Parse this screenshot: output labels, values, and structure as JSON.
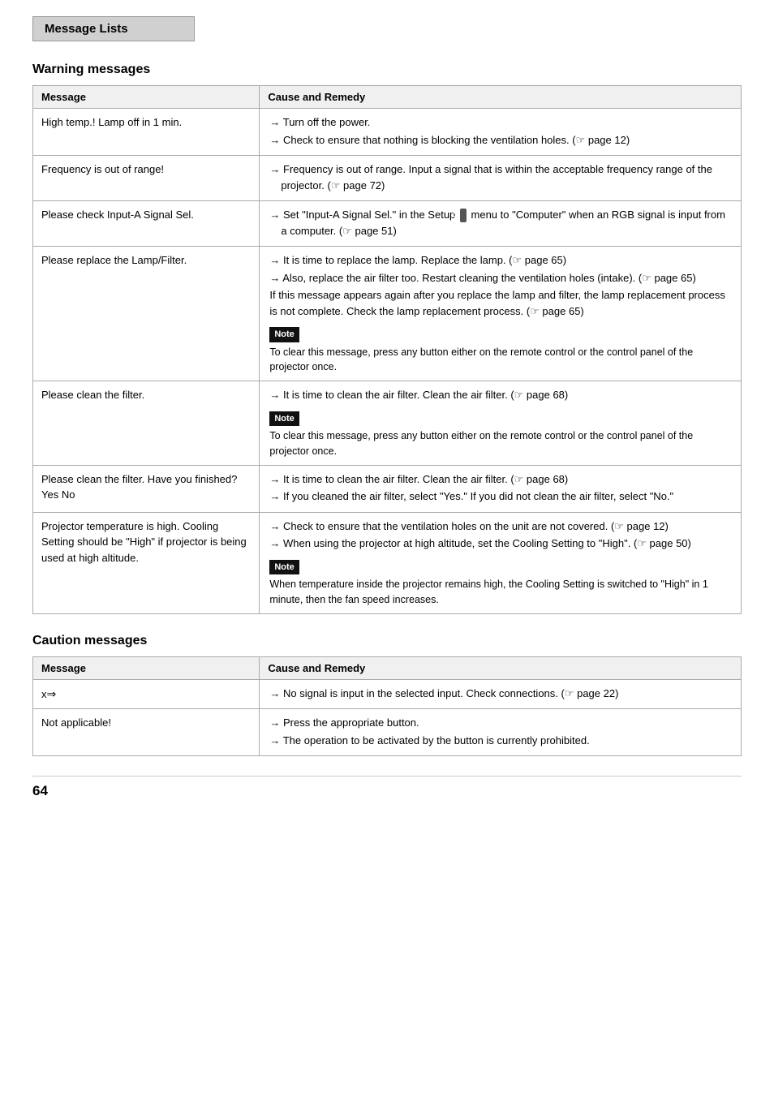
{
  "page": {
    "title": "Message Lists",
    "page_number": "64"
  },
  "warning_section": {
    "heading": "Warning messages",
    "col1": "Message",
    "col2": "Cause and Remedy",
    "rows": [
      {
        "message": "High temp.! Lamp off in 1 min.",
        "remedy": [
          {
            "type": "arrow",
            "text": "Turn off the power."
          },
          {
            "type": "arrow",
            "text": "Check to ensure that nothing is blocking the ventilation holes. (☞ page 12)"
          }
        ],
        "note": null
      },
      {
        "message": "Frequency is out of range!",
        "remedy": [
          {
            "type": "arrow",
            "text": "Frequency is out of range. Input a signal that is within the acceptable frequency range of the projector. (☞ page 72)"
          }
        ],
        "note": null
      },
      {
        "message": "Please check Input-A Signal Sel.",
        "remedy": [
          {
            "type": "arrow",
            "text": "Set \"Input-A Signal Sel.\" in the Setup [icon] menu to \"Computer\" when an RGB signal is input from a computer. (☞ page 51)"
          }
        ],
        "note": null
      },
      {
        "message": "Please replace the Lamp/Filter.",
        "remedy": [
          {
            "type": "arrow",
            "text": "It is time to replace the lamp. Replace the lamp. (☞ page 65)"
          },
          {
            "type": "arrow",
            "text": "Also, replace the air filter too. Restart cleaning the ventilation holes (intake). (☞ page 65)"
          },
          {
            "type": "plain",
            "text": "If this message appears again after you replace the lamp and filter, the lamp replacement process is not complete. Check the lamp replacement process. (☞ page 65)"
          }
        ],
        "note": {
          "label": "Note",
          "text": "To clear this message, press any button either on the remote control or the control panel of the projector once."
        }
      },
      {
        "message": "Please clean the filter.",
        "remedy": [
          {
            "type": "arrow",
            "text": "It is time to clean the air filter. Clean the air filter. (☞ page 68)"
          }
        ],
        "note": {
          "label": "Note",
          "text": "To clear this message, press any button either on the remote control or the control panel of the projector once."
        }
      },
      {
        "message": "Please clean the filter. Have you finished? Yes No",
        "remedy": [
          {
            "type": "arrow",
            "text": "It is time to clean the air filter. Clean the air filter. (☞ page 68)"
          },
          {
            "type": "arrow",
            "text": "If you cleaned the air filter, select \"Yes.\" If you did not clean the air filter, select \"No.\""
          }
        ],
        "note": null
      },
      {
        "message": "Projector temperature is high. Cooling Setting should be \"High\" if projector is being used at high altitude.",
        "remedy": [
          {
            "type": "arrow",
            "text": "Check to ensure that the ventilation holes on the unit are not covered. (☞ page 12)"
          },
          {
            "type": "arrow",
            "text": "When using the projector at high altitude, set the Cooling Setting to \"High\". (☞ page 50)"
          }
        ],
        "note": {
          "label": "Note",
          "text": "When temperature inside the projector remains high, the Cooling Setting is switched to \"High\" in 1 minute, then the fan speed increases."
        }
      }
    ]
  },
  "caution_section": {
    "heading": "Caution messages",
    "col1": "Message",
    "col2": "Cause and Remedy",
    "rows": [
      {
        "message": "x→",
        "remedy": [
          {
            "type": "arrow",
            "text": "No signal is input in the selected input. Check connections. (☞ page 22)"
          }
        ],
        "note": null
      },
      {
        "message": "Not applicable!",
        "remedy": [
          {
            "type": "arrow",
            "text": "Press the appropriate button."
          },
          {
            "type": "arrow",
            "text": "The operation to be activated by the button is currently prohibited."
          }
        ],
        "note": null
      }
    ]
  }
}
